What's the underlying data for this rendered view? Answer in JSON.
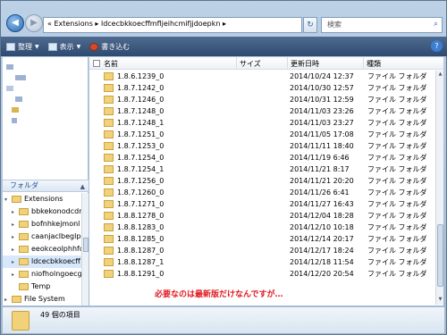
{
  "address_bar": {
    "back_label": "◀",
    "forward_label": "▶",
    "path": "« Extensions ▸ ldcecbkkoecffmfljeihcmifjjdoepkn ▸",
    "search_placeholder": "検索"
  },
  "toolbar": {
    "organize": "整理",
    "view": "表示",
    "burn": "書き込む"
  },
  "sidebar": {
    "header": "フォルダ",
    "tree": [
      {
        "label": "Extensions",
        "arrow": "▾"
      },
      {
        "label": "bbkekonodcdm",
        "arrow": "▸"
      },
      {
        "label": "bofnhkejmonl",
        "arrow": "▸"
      },
      {
        "label": "caanjaclbeglpo",
        "arrow": "▸"
      },
      {
        "label": "eeokceolphhfc",
        "arrow": "▸"
      },
      {
        "label": "ldcecbkkoecff",
        "arrow": "▸"
      },
      {
        "label": "niofholngoecg",
        "arrow": "▸"
      },
      {
        "label": "Temp",
        "arrow": ""
      },
      {
        "label": "File System",
        "arrow": "▸"
      }
    ]
  },
  "columns": {
    "name": "名前",
    "size": "サイズ",
    "date": "更新日時",
    "type": "種類"
  },
  "files": [
    {
      "name": "1.8.6.1239_0",
      "date": "2014/10/24 12:37",
      "type": "ファイル フォルダ"
    },
    {
      "name": "1.8.7.1242_0",
      "date": "2014/10/30 12:57",
      "type": "ファイル フォルダ"
    },
    {
      "name": "1.8.7.1246_0",
      "date": "2014/10/31 12:59",
      "type": "ファイル フォルダ"
    },
    {
      "name": "1.8.7.1248_0",
      "date": "2014/11/03 23:26",
      "type": "ファイル フォルダ"
    },
    {
      "name": "1.8.7.1248_1",
      "date": "2014/11/03 23:27",
      "type": "ファイル フォルダ"
    },
    {
      "name": "1.8.7.1251_0",
      "date": "2014/11/05 17:08",
      "type": "ファイル フォルダ"
    },
    {
      "name": "1.8.7.1253_0",
      "date": "2014/11/11 18:40",
      "type": "ファイル フォルダ"
    },
    {
      "name": "1.8.7.1254_0",
      "date": "2014/11/19 6:46",
      "type": "ファイル フォルダ"
    },
    {
      "name": "1.8.7.1254_1",
      "date": "2014/11/21 8:17",
      "type": "ファイル フォルダ"
    },
    {
      "name": "1.8.7.1256_0",
      "date": "2014/11/21 20:20",
      "type": "ファイル フォルダ"
    },
    {
      "name": "1.8.7.1260_0",
      "date": "2014/11/26 6:41",
      "type": "ファイル フォルダ"
    },
    {
      "name": "1.8.7.1271_0",
      "date": "2014/11/27 16:43",
      "type": "ファイル フォルダ"
    },
    {
      "name": "1.8.8.1278_0",
      "date": "2014/12/04 18:28",
      "type": "ファイル フォルダ"
    },
    {
      "name": "1.8.8.1283_0",
      "date": "2014/12/10 10:18",
      "type": "ファイル フォルダ"
    },
    {
      "name": "1.8.8.1285_0",
      "date": "2014/12/14 20:17",
      "type": "ファイル フォルダ"
    },
    {
      "name": "1.8.8.1287_0",
      "date": "2014/12/17 18:24",
      "type": "ファイル フォルダ"
    },
    {
      "name": "1.8.8.1287_1",
      "date": "2014/12/18 11:54",
      "type": "ファイル フォルダ"
    },
    {
      "name": "1.8.8.1291_0",
      "date": "2014/12/20 20:54",
      "type": "ファイル フォルダ"
    }
  ],
  "annotation": "必要なのは最新版だけなんですが…",
  "status": {
    "item_count": "49 個の項目"
  }
}
